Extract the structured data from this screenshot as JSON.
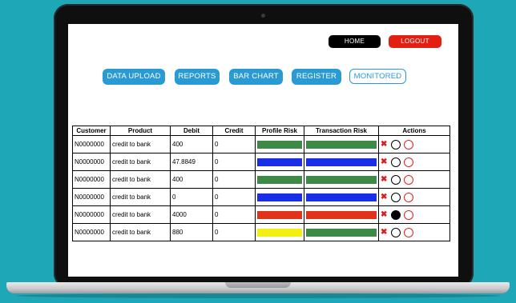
{
  "header": {
    "home_label": "HOME",
    "logout_label": "LOGOUT"
  },
  "nav": {
    "items": [
      {
        "label": "DATA UPLOAD"
      },
      {
        "label": "REPORTS"
      },
      {
        "label": "BAR CHART"
      },
      {
        "label": "REGISTER"
      },
      {
        "label": "MONITORED"
      }
    ]
  },
  "table": {
    "columns": [
      "Customer",
      "Product",
      "Debit",
      "Credit",
      "Profile Risk",
      "Transaction Risk",
      "Actions"
    ],
    "rows": [
      {
        "customer": "N0000000",
        "product": "credit to bank",
        "debit": "400",
        "credit": "0",
        "profile_risk_color": "#3d8a47",
        "transaction_risk_color": "#3d8a47",
        "flag": "outline"
      },
      {
        "customer": "N0000000",
        "product": "credit to bank",
        "debit": "47.8849",
        "credit": "0",
        "profile_risk_color": "#1a2ee8",
        "transaction_risk_color": "#1a2ee8",
        "flag": "outline"
      },
      {
        "customer": "N0000000",
        "product": "credit to bank",
        "debit": "400",
        "credit": "0",
        "profile_risk_color": "#3d8a47",
        "transaction_risk_color": "#3d8a47",
        "flag": "outline"
      },
      {
        "customer": "N0000000",
        "product": "credit to bank",
        "debit": "0",
        "credit": "0",
        "profile_risk_color": "#1a2ee8",
        "transaction_risk_color": "#1a2ee8",
        "flag": "outline"
      },
      {
        "customer": "N0000000",
        "product": "credit to bank",
        "debit": "4000",
        "credit": "0",
        "profile_risk_color": "#e2321b",
        "transaction_risk_color": "#e2321b",
        "flag": "filled"
      },
      {
        "customer": "N0000000",
        "product": "credit to bank",
        "debit": "880",
        "credit": "0",
        "profile_risk_color": "#f4ef13",
        "transaction_risk_color": "#3d8a47",
        "flag": "outline"
      }
    ],
    "action_icons": [
      "close-icon",
      "flag-circle-icon",
      "alert-circle-icon"
    ],
    "colors": {
      "close": "#d42020",
      "red_circle": "#e01e1e",
      "black_circle": "#000000"
    }
  },
  "colors": {
    "background": "#1ea7b7",
    "nav_button": "#2a9ad3",
    "home_button": "#000000",
    "logout_button": "#e21f10"
  }
}
